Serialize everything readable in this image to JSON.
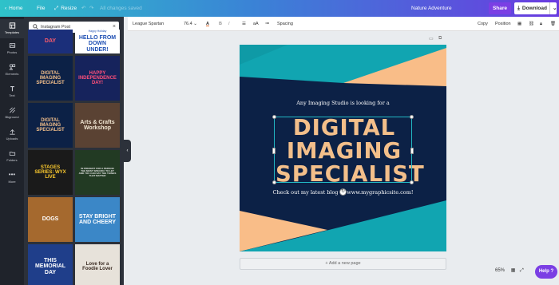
{
  "topbar": {
    "home": "Home",
    "file": "File",
    "resize": "Resize",
    "saved_status": "All changes saved",
    "doc_title": "Nature Adventure",
    "share": "Share",
    "download": "Download"
  },
  "rail": {
    "templates": "Templates",
    "photos": "Photos",
    "elements": "Elements",
    "text": "Text",
    "bkground": "Bkground",
    "uploads": "Uploads",
    "folders": "Folders",
    "more": "More"
  },
  "panel": {
    "search_value": "Instagram Post",
    "thumbs": [
      {
        "label": "DAY",
        "bg": "#1b2f7a",
        "fg": "#ff5b6b"
      },
      {
        "label": "HELLO FROM DOWN UNDER!",
        "bg": "#ffffff",
        "fg": "#1e4fb3",
        "sub": "Happy Holiday"
      },
      {
        "label": "DIGITAL IMAGING SPECIALIST",
        "bg": "#0c2146",
        "fg": "#f3bf8a"
      },
      {
        "label": "HAPPY INDEPENDENCE DAY!",
        "bg": "#16235c",
        "fg": "#ff4f79"
      },
      {
        "label": "DIGITAL IMAGING SPECIALIST",
        "bg": "#0c2146",
        "fg": "#f3bf8a"
      },
      {
        "label": "Arts & Crafts Workshop",
        "bg": "#5a4233",
        "fg": "#f1e6d3"
      },
      {
        "label": "STAGES SERIES: WYX LIVE",
        "bg": "#1a1a1a",
        "fg": "#ffcc2e"
      },
      {
        "label": "IN PRESENT FOR A PERSON THE MOST SPECIFIC TO LET AND YOU CAN SAY THE THINGS THAT MATTER",
        "bg": "#223a23",
        "fg": "#e8e8e8"
      },
      {
        "label": "DOGS",
        "bg": "#a5692e",
        "fg": "#ffffff"
      },
      {
        "label": "STAY BRIGHT AND CHEERY",
        "bg": "#3b87c7",
        "fg": "#ffffff"
      },
      {
        "label": "THIS MEMORIAL DAY",
        "bg": "#1f3e8a",
        "fg": "#ffffff"
      },
      {
        "label": "Love for a Foodie Lover",
        "bg": "#e7e2da",
        "fg": "#3a2b22"
      }
    ]
  },
  "toolbar": {
    "font": "League Spartan",
    "size": "76.4",
    "spacing": "Spacing",
    "copy": "Copy",
    "position": "Position",
    "case": "aA"
  },
  "canvas": {
    "intro": "Any Imaging Studio is looking for a",
    "headline_1": "DIGITAL",
    "headline_2": "IMAGING",
    "headline_3": "SPECIALIST",
    "footer": "Check out my latest blog at www.mygraphicsite.com!",
    "add_page": "+ Add a new page"
  },
  "footer_controls": {
    "zoom": "65%",
    "help": "Help ?"
  },
  "colors": {
    "navy": "#0c2146",
    "teal": "#11a5b1",
    "peach": "#f9bd88",
    "purple": "#7b3fe4"
  }
}
